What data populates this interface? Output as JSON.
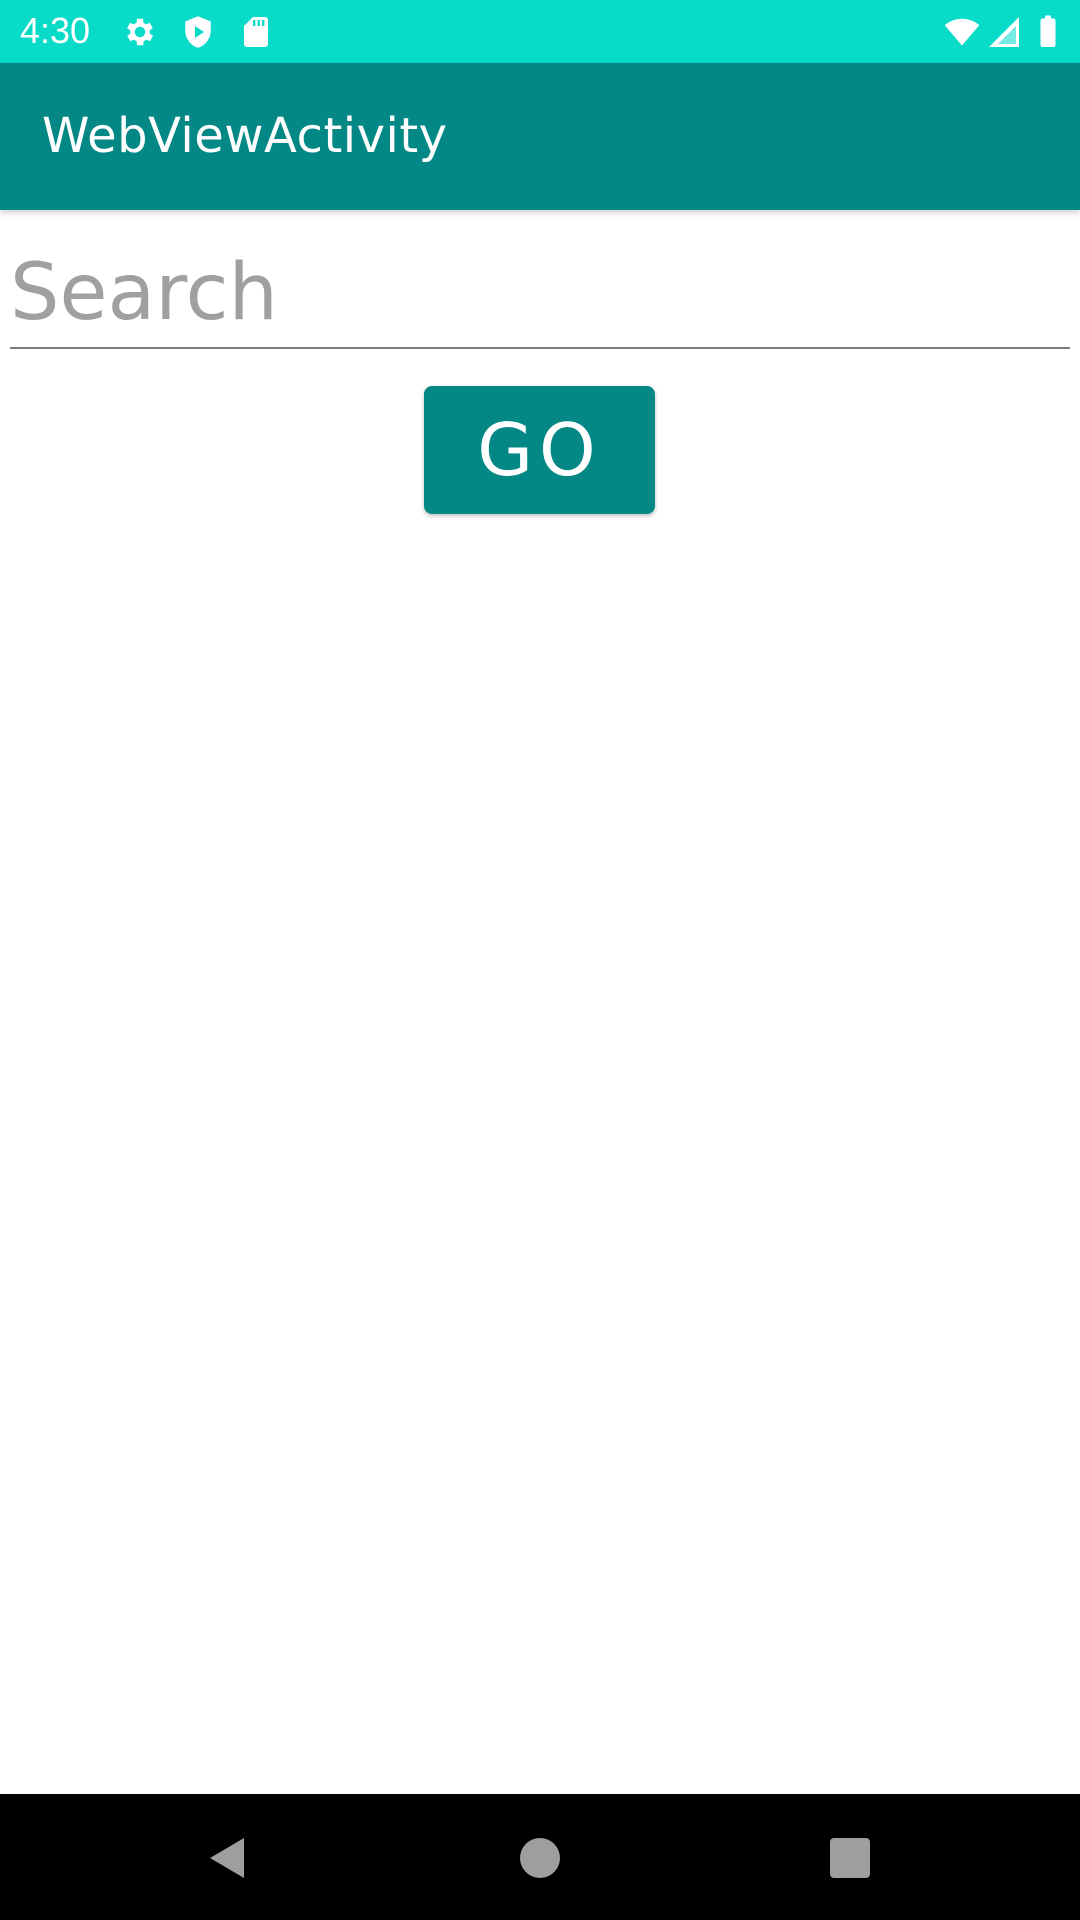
{
  "status_bar": {
    "time": "4:30",
    "icons": [
      "settings-icon",
      "shield-play-icon",
      "sd-card-icon",
      "wifi-icon",
      "signal-icon",
      "battery-icon"
    ]
  },
  "app_bar": {
    "title": "WebViewActivity"
  },
  "search": {
    "placeholder": "Search",
    "value": ""
  },
  "go_button": {
    "label": "GO"
  },
  "navigation": {
    "icons": [
      "back-icon",
      "home-icon",
      "recents-icon"
    ]
  },
  "colors": {
    "status_bar": "#08dbc8",
    "primary": "#038886",
    "nav_bar": "#000000"
  }
}
